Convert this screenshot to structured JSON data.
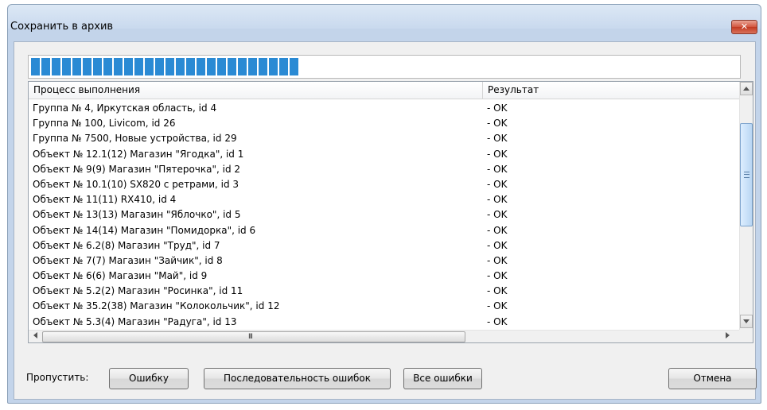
{
  "window": {
    "title": "Сохранить в архив",
    "close_glyph": "✕"
  },
  "progress": {
    "value": 0.38
  },
  "list": {
    "columns": [
      "Процесс выполнения",
      "Результат"
    ],
    "rows": [
      {
        "process": "Группа № 4, Иркутская область, id 4",
        "result": "- OK"
      },
      {
        "process": "Группа № 100, Livicom, id 26",
        "result": "- OK"
      },
      {
        "process": "Группа № 7500, Новые устройства, id 29",
        "result": "- OK"
      },
      {
        "process": "Объект № 12.1(12) Магазин \"Ягодка\", id 1",
        "result": "- OK"
      },
      {
        "process": "Объект № 9(9) Магазин \"Пятерочка\", id 2",
        "result": "- OK"
      },
      {
        "process": "Объект № 10.1(10) SX820 с ретрами, id 3",
        "result": "- OK"
      },
      {
        "process": "Объект № 11(11) RX410, id 4",
        "result": "- OK"
      },
      {
        "process": "Объект № 13(13) Магазин \"Яблочко\", id 5",
        "result": "- OK"
      },
      {
        "process": "Объект № 14(14) Магазин \"Помидорка\", id 6",
        "result": "- OK"
      },
      {
        "process": "Объект № 6.2(8) Магазин \"Труд\", id 7",
        "result": "- OK"
      },
      {
        "process": "Объект № 7(7) Магазин \"Зайчик\", id 8",
        "result": "- OK"
      },
      {
        "process": "Объект № 6(6) Магазин \"Май\", id 9",
        "result": "- OK"
      },
      {
        "process": "Объект № 5.2(2) Магазин \"Росинка\", id 11",
        "result": "- OK"
      },
      {
        "process": "Объект № 35.2(38) Магазин \"Колокольчик\", id 12",
        "result": "- OK"
      },
      {
        "process": "Объект № 5.3(4) Магазин \"Радуга\", id 13",
        "result": "- OK"
      }
    ]
  },
  "scrollbars": {
    "up_icon": "up-arrow-icon",
    "down_icon": "down-arrow-icon",
    "left_icon": "left-arrow-icon",
    "right_icon": "right-arrow-icon",
    "hgrip": "III"
  },
  "footer": {
    "skip_label": "Пропустить:",
    "btn_error": "Ошибку",
    "btn_sequence": "Последовательность ошибок",
    "btn_all": "Все ошибки",
    "btn_cancel": "Отмена"
  }
}
